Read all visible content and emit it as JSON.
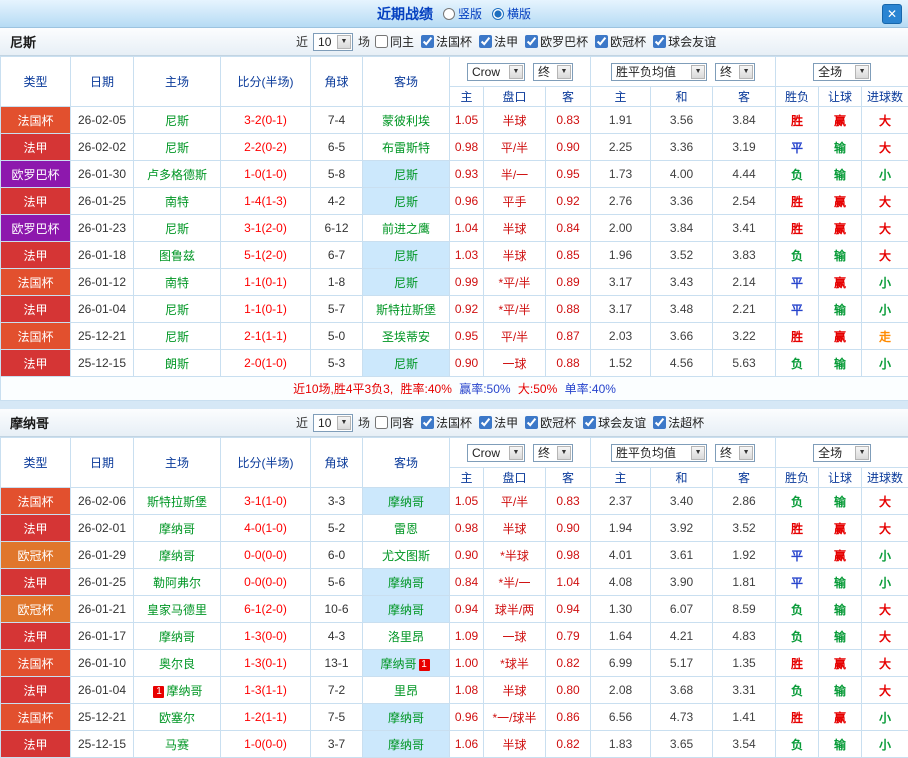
{
  "titlebar": {
    "title": "近期战绩",
    "layout_options": [
      {
        "label": "竖版",
        "selected": false
      },
      {
        "label": "横版",
        "selected": true
      }
    ]
  },
  "icons": {
    "close": "✕",
    "dropdown": "▼"
  },
  "colors": {
    "comp": {
      "法国杯": "#e2502e",
      "法甲": "#d53535",
      "欧罗巴杯": "#8d18ad",
      "欧冠杯": "#e0762c"
    },
    "result": {
      "胜": "#e60000",
      "平": "#2744cc",
      "负": "#089b38",
      "赢": "#e60000",
      "输": "#089b38",
      "大": "#e60000",
      "小": "#089b38",
      "走": "#ff8a00"
    },
    "team": "#009624",
    "score": "#ff0000",
    "asian_odds": "#cf1010",
    "euro_odds": "#404040",
    "highlight_bg": "#cce8fc"
  },
  "table": {
    "columns": [
      "类型",
      "日期",
      "主场",
      "比分(半场)",
      "角球",
      "客场"
    ],
    "sub_columns": [
      "主",
      "盘口",
      "客",
      "主",
      "和",
      "客",
      "胜负",
      "让球",
      "进球数"
    ],
    "selects": {
      "bookmaker": "Crow",
      "final1": "终",
      "odds_avg": "胜平负均值",
      "final2": "终",
      "scope": "全场"
    }
  },
  "sections": [
    {
      "team": "尼斯",
      "filters": {
        "near_label": "近",
        "count": "10",
        "unit_label": "场",
        "venue_label": "同主",
        "leagues": [
          "法国杯",
          "法甲",
          "欧罗巴杯",
          "欧冠杯",
          "球会友谊"
        ]
      },
      "rows": [
        {
          "comp": "法国杯",
          "date": "26-02-05",
          "home": "尼斯",
          "score": "3-2(0-1)",
          "corner": "7-4",
          "away": "蒙彼利埃",
          "asian": [
            "1.05",
            "半球",
            "0.83"
          ],
          "euro": [
            "1.91",
            "3.56",
            "3.84"
          ],
          "results": [
            "胜",
            "赢",
            "大"
          ]
        },
        {
          "comp": "法甲",
          "date": "26-02-02",
          "home": "尼斯",
          "score": "2-2(0-2)",
          "corner": "6-5",
          "away": "布雷斯特",
          "asian": [
            "0.98",
            "平/半",
            "0.90"
          ],
          "euro": [
            "2.25",
            "3.36",
            "3.19"
          ],
          "results": [
            "平",
            "输",
            "大"
          ]
        },
        {
          "comp": "欧罗巴杯",
          "date": "26-01-30",
          "home": "卢多格德斯",
          "score": "1-0(1-0)",
          "corner": "5-8",
          "away": "尼斯",
          "asian": [
            "0.93",
            "半/一",
            "0.95"
          ],
          "euro": [
            "1.73",
            "4.00",
            "4.44"
          ],
          "results": [
            "负",
            "输",
            "小"
          ]
        },
        {
          "comp": "法甲",
          "date": "26-01-25",
          "home": "南特",
          "score": "1-4(1-3)",
          "corner": "4-2",
          "away": "尼斯",
          "asian": [
            "0.96",
            "平手",
            "0.92"
          ],
          "euro": [
            "2.76",
            "3.36",
            "2.54"
          ],
          "results": [
            "胜",
            "赢",
            "大"
          ]
        },
        {
          "comp": "欧罗巴杯",
          "date": "26-01-23",
          "home": "尼斯",
          "score": "3-1(2-0)",
          "corner": "6-12",
          "away": "前进之鹰",
          "asian": [
            "1.04",
            "半球",
            "0.84"
          ],
          "euro": [
            "2.00",
            "3.84",
            "3.41"
          ],
          "results": [
            "胜",
            "赢",
            "大"
          ]
        },
        {
          "comp": "法甲",
          "date": "26-01-18",
          "home": "图鲁兹",
          "score": "5-1(2-0)",
          "corner": "6-7",
          "away": "尼斯",
          "asian": [
            "1.03",
            "半球",
            "0.85"
          ],
          "euro": [
            "1.96",
            "3.52",
            "3.83"
          ],
          "results": [
            "负",
            "输",
            "大"
          ]
        },
        {
          "comp": "法国杯",
          "date": "26-01-12",
          "home": "南特",
          "score": "1-1(0-1)",
          "corner": "1-8",
          "away": "尼斯",
          "asian": [
            "0.99",
            "*平/半",
            "0.89"
          ],
          "euro": [
            "3.17",
            "3.43",
            "2.14"
          ],
          "results": [
            "平",
            "赢",
            "小"
          ]
        },
        {
          "comp": "法甲",
          "date": "26-01-04",
          "home": "尼斯",
          "score": "1-1(0-1)",
          "corner": "5-7",
          "away": "斯特拉斯堡",
          "asian": [
            "0.92",
            "*平/半",
            "0.88"
          ],
          "euro": [
            "3.17",
            "3.48",
            "2.21"
          ],
          "results": [
            "平",
            "输",
            "小"
          ]
        },
        {
          "comp": "法国杯",
          "date": "25-12-21",
          "home": "尼斯",
          "score": "2-1(1-1)",
          "corner": "5-0",
          "away": "圣埃蒂安",
          "asian": [
            "0.95",
            "平/半",
            "0.87"
          ],
          "euro": [
            "2.03",
            "3.66",
            "3.22"
          ],
          "results": [
            "胜",
            "赢",
            "走"
          ]
        },
        {
          "comp": "法甲",
          "date": "25-12-15",
          "home": "朗斯",
          "score": "2-0(1-0)",
          "corner": "5-3",
          "away": "尼斯",
          "asian": [
            "0.90",
            "一球",
            "0.88"
          ],
          "euro": [
            "1.52",
            "4.56",
            "5.63"
          ],
          "results": [
            "负",
            "输",
            "小"
          ]
        }
      ],
      "summary": [
        {
          "text": "近10场,胜4平3负3,",
          "color": "#e60000"
        },
        {
          "text": " 胜率:40%",
          "color": "#e60000"
        },
        {
          "text": " 赢率:50%",
          "color": "#2744cc"
        },
        {
          "text": " 大:50%",
          "color": "#e60000"
        },
        {
          "text": " 单率:40%",
          "color": "#2744cc"
        }
      ]
    },
    {
      "team": "摩纳哥",
      "filters": {
        "near_label": "近",
        "count": "10",
        "unit_label": "场",
        "venue_label": "同客",
        "leagues": [
          "法国杯",
          "法甲",
          "欧冠杯",
          "球会友谊",
          "法超杯"
        ]
      },
      "rows": [
        {
          "comp": "法国杯",
          "date": "26-02-06",
          "home": "斯特拉斯堡",
          "score": "3-1(1-0)",
          "corner": "3-3",
          "away": "摩纳哥",
          "asian": [
            "1.05",
            "平/半",
            "0.83"
          ],
          "euro": [
            "2.37",
            "3.40",
            "2.86"
          ],
          "results": [
            "负",
            "输",
            "大"
          ]
        },
        {
          "comp": "法甲",
          "date": "26-02-01",
          "home": "摩纳哥",
          "score": "4-0(1-0)",
          "corner": "5-2",
          "away": "雷恩",
          "asian": [
            "0.98",
            "半球",
            "0.90"
          ],
          "euro": [
            "1.94",
            "3.92",
            "3.52"
          ],
          "results": [
            "胜",
            "赢",
            "大"
          ]
        },
        {
          "comp": "欧冠杯",
          "date": "26-01-29",
          "home": "摩纳哥",
          "score": "0-0(0-0)",
          "corner": "6-0",
          "away": "尤文图斯",
          "asian": [
            "0.90",
            "*半球",
            "0.98"
          ],
          "euro": [
            "4.01",
            "3.61",
            "1.92"
          ],
          "results": [
            "平",
            "赢",
            "小"
          ]
        },
        {
          "comp": "法甲",
          "date": "26-01-25",
          "home": "勒阿弗尔",
          "score": "0-0(0-0)",
          "corner": "5-6",
          "away": "摩纳哥",
          "asian": [
            "0.84",
            "*半/一",
            "1.04"
          ],
          "euro": [
            "4.08",
            "3.90",
            "1.81"
          ],
          "results": [
            "平",
            "输",
            "小"
          ]
        },
        {
          "comp": "欧冠杯",
          "date": "26-01-21",
          "home": "皇家马德里",
          "score": "6-1(2-0)",
          "corner": "10-6",
          "away": "摩纳哥",
          "asian": [
            "0.94",
            "球半/两",
            "0.94"
          ],
          "euro": [
            "1.30",
            "6.07",
            "8.59"
          ],
          "results": [
            "负",
            "输",
            "大"
          ]
        },
        {
          "comp": "法甲",
          "date": "26-01-17",
          "home": "摩纳哥",
          "score": "1-3(0-0)",
          "corner": "4-3",
          "away": "洛里昂",
          "asian": [
            "1.09",
            "一球",
            "0.79"
          ],
          "euro": [
            "1.64",
            "4.21",
            "4.83"
          ],
          "results": [
            "负",
            "输",
            "大"
          ]
        },
        {
          "comp": "法国杯",
          "date": "26-01-10",
          "home": "奥尔良",
          "score": "1-3(0-1)",
          "corner": "13-1",
          "away": "摩纳哥",
          "arc": "1",
          "asian": [
            "1.00",
            "*球半",
            "0.82"
          ],
          "euro": [
            "6.99",
            "5.17",
            "1.35"
          ],
          "results": [
            "胜",
            "赢",
            "大"
          ]
        },
        {
          "comp": "法甲",
          "date": "26-01-04",
          "home": "摩纳哥",
          "hrc": "1",
          "score": "1-3(1-1)",
          "corner": "7-2",
          "away": "里昂",
          "asian": [
            "1.08",
            "半球",
            "0.80"
          ],
          "euro": [
            "2.08",
            "3.68",
            "3.31"
          ],
          "results": [
            "负",
            "输",
            "大"
          ]
        },
        {
          "comp": "法国杯",
          "date": "25-12-21",
          "home": "欧塞尔",
          "score": "1-2(1-1)",
          "corner": "7-5",
          "away": "摩纳哥",
          "asian": [
            "0.96",
            "*一/球半",
            "0.86"
          ],
          "euro": [
            "6.56",
            "4.73",
            "1.41"
          ],
          "results": [
            "胜",
            "赢",
            "小"
          ]
        },
        {
          "comp": "法甲",
          "date": "25-12-15",
          "home": "马赛",
          "score": "1-0(0-0)",
          "corner": "3-7",
          "away": "摩纳哥",
          "asian": [
            "1.06",
            "半球",
            "0.82"
          ],
          "euro": [
            "1.83",
            "3.65",
            "3.54"
          ],
          "results": [
            "负",
            "输",
            "小"
          ]
        }
      ]
    }
  ]
}
